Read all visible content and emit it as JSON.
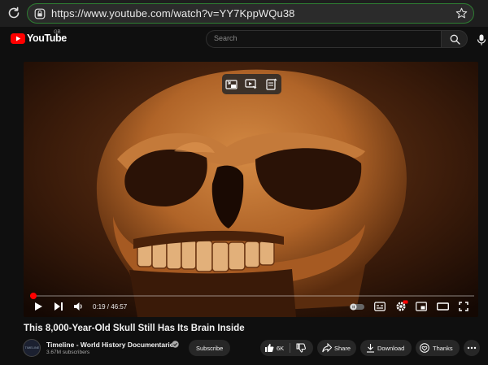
{
  "browser": {
    "url": "https://www.youtube.com/watch?v=YY7KppWQu38",
    "icons": [
      "reload-icon",
      "lock-icon",
      "star-icon"
    ]
  },
  "header": {
    "wordmark": "YouTube",
    "region": "GB",
    "search_placeholder": "Search",
    "icons": [
      "youtube-logo-icon",
      "search-icon",
      "mic-icon"
    ]
  },
  "player": {
    "time_display": "0:19 / 46:57",
    "progress_percent": 0.67,
    "progress_color": "#ff0000",
    "icons": [
      "miniplayer-icon",
      "cast-icon",
      "notes-icon",
      "play-icon",
      "next-icon",
      "volume-icon",
      "autoplay-toggle",
      "captions-icon",
      "settings-icon",
      "miniplayer-small-icon",
      "theater-icon",
      "fullscreen-icon"
    ]
  },
  "video": {
    "title": "This 8,000-Year-Old Skull Still Has Its Brain Inside"
  },
  "channel": {
    "name": "Timeline - World History Documentaries",
    "subscribers": "3.67M subscribers",
    "avatar_text": "TIMELINE",
    "subscribe_label": "Subscribe"
  },
  "actions": {
    "likes": "6K",
    "share_label": "Share",
    "download_label": "Download",
    "thanks_label": "Thanks"
  }
}
